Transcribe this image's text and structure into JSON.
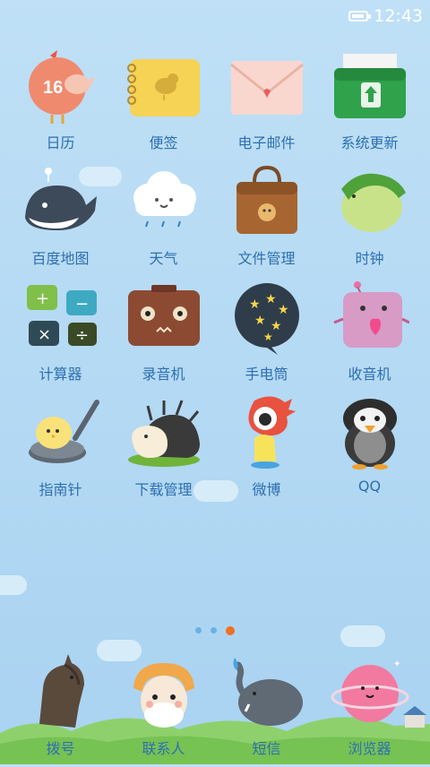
{
  "status": {
    "time": "12:43",
    "battery_level": 0.9
  },
  "apps": [
    {
      "label": "日历",
      "icon": "calendar-icon",
      "badge": "16"
    },
    {
      "label": "便签",
      "icon": "notes-icon"
    },
    {
      "label": "电子邮件",
      "icon": "email-icon"
    },
    {
      "label": "系统更新",
      "icon": "system-update-icon"
    },
    {
      "label": "百度地图",
      "icon": "baidu-map-icon"
    },
    {
      "label": "天气",
      "icon": "weather-icon"
    },
    {
      "label": "文件管理",
      "icon": "file-manager-icon"
    },
    {
      "label": "时钟",
      "icon": "clock-icon"
    },
    {
      "label": "计算器",
      "icon": "calculator-icon"
    },
    {
      "label": "录音机",
      "icon": "recorder-icon"
    },
    {
      "label": "手电筒",
      "icon": "flashlight-icon"
    },
    {
      "label": "收音机",
      "icon": "radio-icon"
    },
    {
      "label": "指南针",
      "icon": "compass-icon"
    },
    {
      "label": "下载管理",
      "icon": "download-manager-icon"
    },
    {
      "label": "微博",
      "icon": "weibo-icon"
    },
    {
      "label": "QQ",
      "icon": "qq-icon"
    }
  ],
  "page_indicator": {
    "count": 3,
    "active": 3
  },
  "dock": [
    {
      "label": "拨号",
      "icon": "phone-dialer-icon"
    },
    {
      "label": "联系人",
      "icon": "contacts-icon"
    },
    {
      "label": "短信",
      "icon": "messages-icon"
    },
    {
      "label": "浏览器",
      "icon": "browser-icon"
    }
  ],
  "colors": {
    "accent": "#f0701d",
    "label": "#2e6fb0",
    "sky": "#b2d8f3"
  }
}
